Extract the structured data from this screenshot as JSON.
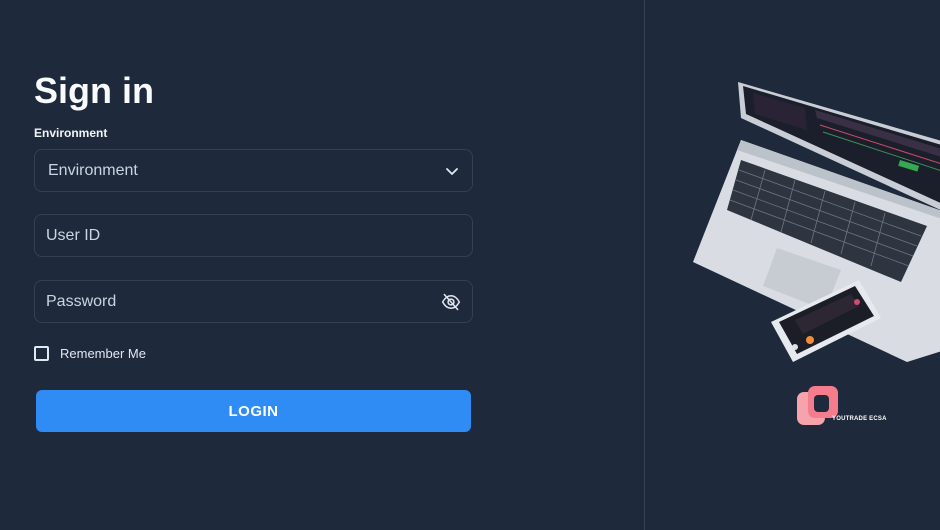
{
  "signin": {
    "title": "Sign in",
    "environment_label": "Environment",
    "environment_value": "Environment",
    "user_id_placeholder": "User ID",
    "password_placeholder": "Password",
    "remember_me_label": "Remember Me",
    "remember_me_checked": false,
    "login_label": "LOGIN"
  },
  "brand": {
    "name": "YOUTRADE ECSA"
  },
  "colors": {
    "background": "#1e293b",
    "accent": "#2f8cf5",
    "border": "#334155",
    "brand_logo": "#f47c8c"
  },
  "icons": {
    "environment_dropdown": "chevron-down-icon",
    "password_visibility": "eye-off-icon",
    "brand": "youtrade-logo-icon"
  }
}
